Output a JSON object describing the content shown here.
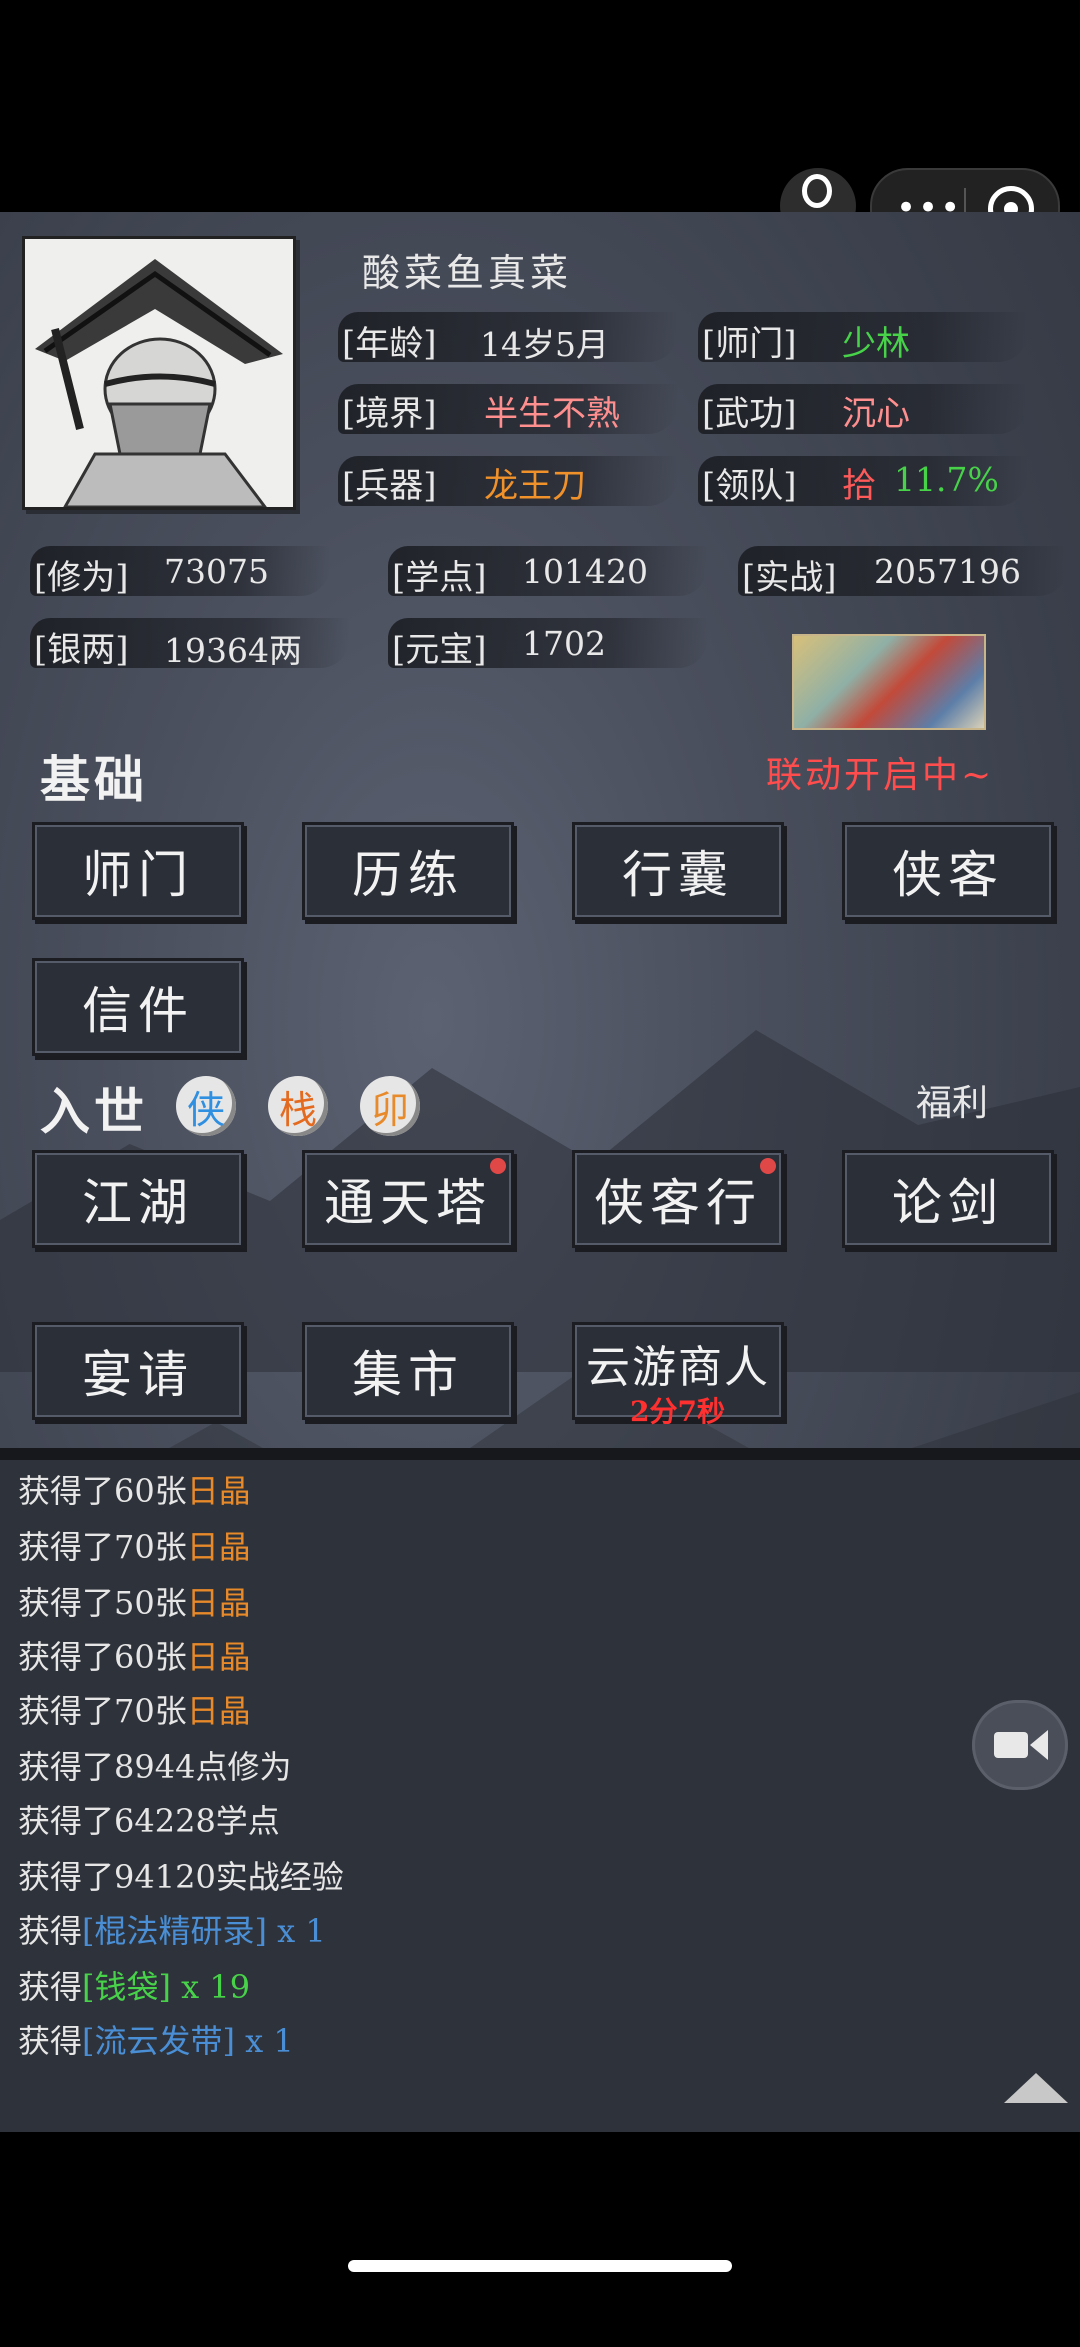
{
  "player": {
    "name": "酸菜鱼真菜",
    "age_label": "[年龄]",
    "age": "14岁5月",
    "sect_label": "[师门]",
    "sect": "少林",
    "realm_label": "[境界]",
    "realm": "半生不熟",
    "skill_label": "[武功]",
    "skill": "沉心",
    "weapon_label": "[兵器]",
    "weapon": "龙王刀",
    "team_label": "[领队]",
    "team_member": "拾",
    "team_value": "11.7%"
  },
  "stats": {
    "cultivation_label": "[修为]",
    "cultivation": "73075",
    "study_label": "[学点]",
    "study": "101420",
    "combat_label": "[实战]",
    "combat": "2057196",
    "silver_label": "[银两]",
    "silver": "19364两",
    "ingot_label": "[元宝]",
    "ingot": "1702"
  },
  "basics": {
    "title": "基础",
    "promo": "联动开启中~",
    "buttons": [
      "师门",
      "历练",
      "行囊",
      "侠客",
      "信件"
    ]
  },
  "world": {
    "title": "入世",
    "badges": [
      "侠",
      "栈",
      "卯"
    ],
    "welfare": "福利",
    "buttons": [
      "江湖",
      "通天塔",
      "侠客行",
      "论剑",
      "宴请",
      "集市",
      "云游商人"
    ],
    "merchant_timer": "2分7秒"
  },
  "log": [
    {
      "prefix": "获得了60张",
      "item": "日晶"
    },
    {
      "prefix": "获得了70张",
      "item": "日晶"
    },
    {
      "prefix": "获得了50张",
      "item": "日晶"
    },
    {
      "prefix": "获得了60张",
      "item": "日晶"
    },
    {
      "prefix": "获得了70张",
      "item": "日晶"
    },
    {
      "prefix": "获得了8944点修为",
      "item": ""
    },
    {
      "prefix": "获得了64228学点",
      "item": ""
    },
    {
      "prefix": "获得了94120实战经验",
      "item": ""
    },
    {
      "prefix": "获得",
      "item": "[棍法精研录] x 1"
    },
    {
      "prefix": "获得",
      "item": "[钱袋] x 19"
    },
    {
      "prefix": "获得",
      "item": "[流云发带] x 1"
    }
  ],
  "colors": {
    "sect": "#47d24a",
    "realm": "#ff8f8f",
    "weapon": "#f0912a",
    "team_member": "#ff5a5a",
    "team_value": "#47d24a",
    "promo": "#ff4d4d",
    "log_crystal": "#e8892a",
    "log_blue": "#4a8fd6",
    "log_green": "#47d24a"
  },
  "icons": [
    "robot-icon",
    "more-dots-icon",
    "close-target-icon",
    "camera-icon",
    "scroll-top-icon"
  ]
}
